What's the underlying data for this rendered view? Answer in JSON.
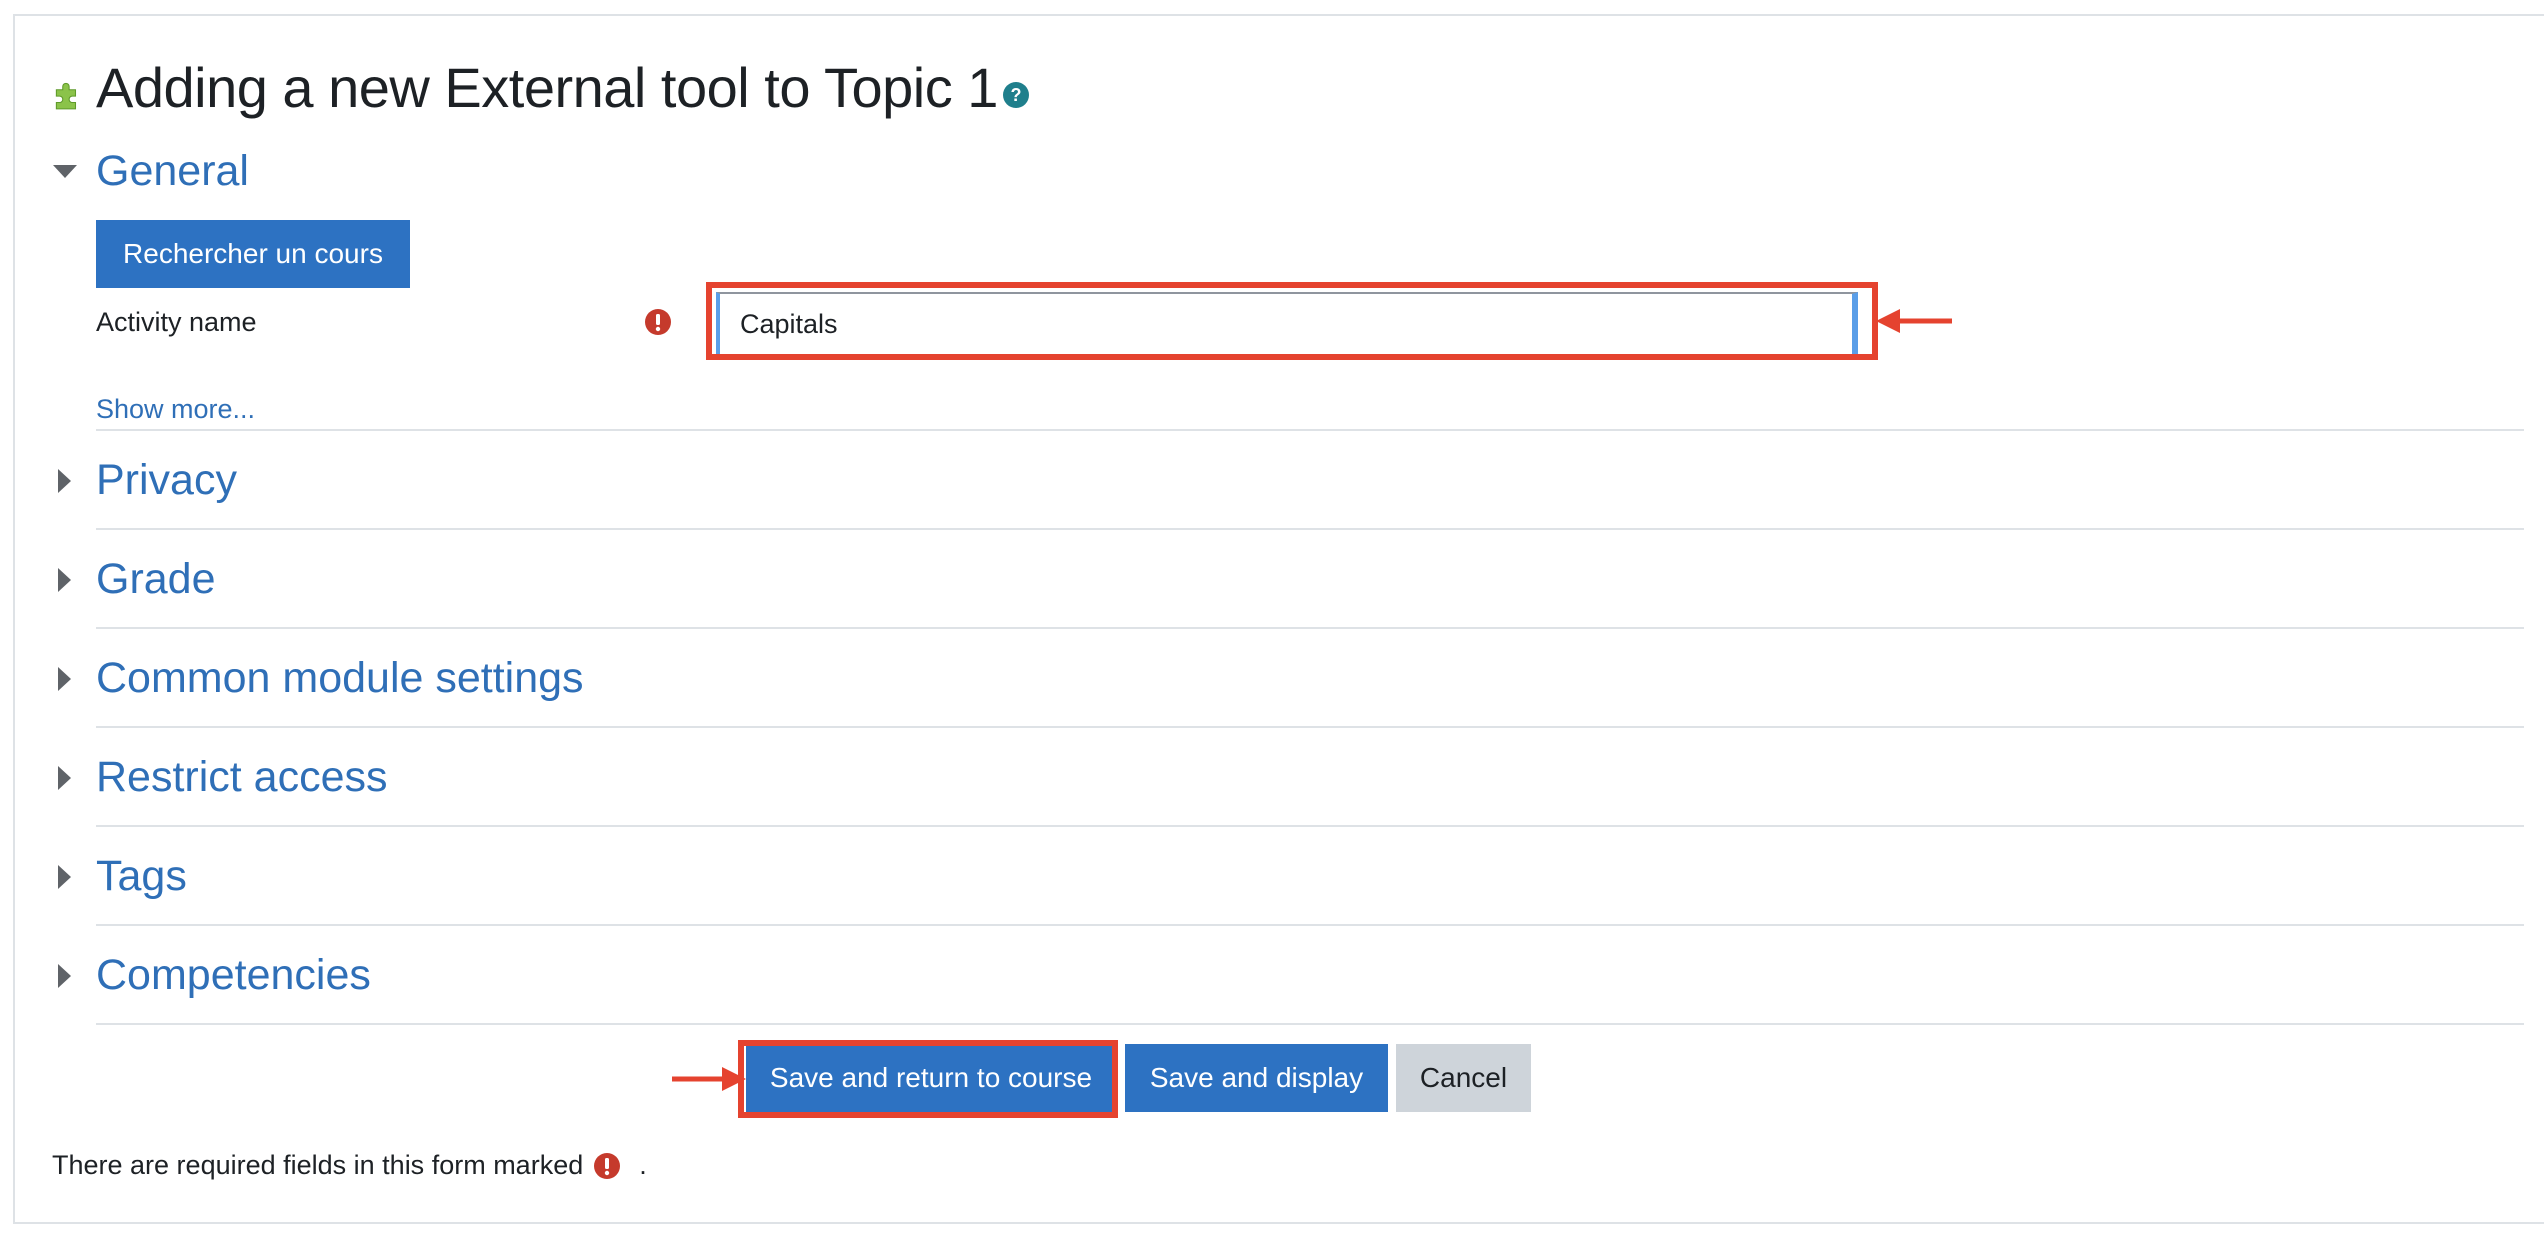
{
  "page": {
    "title": "Adding a new External tool to Topic 1"
  },
  "sections": [
    {
      "label": "General",
      "expanded": true
    },
    {
      "label": "Privacy",
      "expanded": false
    },
    {
      "label": "Grade",
      "expanded": false
    },
    {
      "label": "Common module settings",
      "expanded": false
    },
    {
      "label": "Restrict access",
      "expanded": false
    },
    {
      "label": "Tags",
      "expanded": false
    },
    {
      "label": "Competencies",
      "expanded": false
    }
  ],
  "general": {
    "search_course_button": "Rechercher un cours",
    "activity_name_label": "Activity name",
    "activity_name_value": "Capitals",
    "show_more": "Show more..."
  },
  "actions": {
    "save_return": "Save and return to course",
    "save_display": "Save and display",
    "cancel": "Cancel"
  },
  "footer": {
    "required_note": "There are required fields in this form marked",
    "required_note_suffix": "."
  },
  "colors": {
    "accent": "#2d72c2",
    "link": "#2f6fb7",
    "annotation": "#e5432f",
    "required": "#c53a2c"
  },
  "icons": {
    "title": "puzzle-piece-icon",
    "help": "help-question-icon",
    "required": "required-exclamation-icon",
    "expanded": "caret-down-icon",
    "collapsed": "caret-right-icon"
  }
}
